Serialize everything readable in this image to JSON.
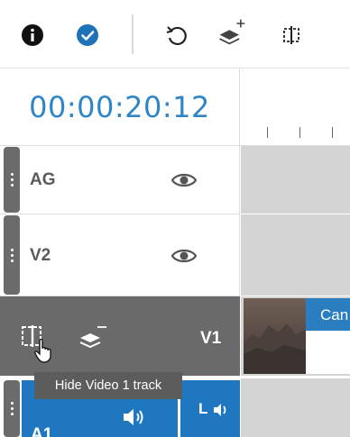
{
  "timecode": "00:00:20:12",
  "tracks": [
    {
      "name": "AG"
    },
    {
      "name": "V2"
    },
    {
      "name": "V1"
    },
    {
      "name": "A1"
    }
  ],
  "clip": {
    "label": "Can"
  },
  "audio": {
    "channel_label": "L"
  },
  "tooltip": "Hide Video 1 track",
  "icons": {
    "info": "info-icon",
    "check": "check-circle-icon",
    "undo": "undo-icon",
    "add_track": "layers-plus-icon",
    "split": "split-icon",
    "eye": "eye-icon",
    "hide_track": "hide-track-icon",
    "remove_layer": "layers-minus-icon",
    "speaker": "speaker-icon"
  },
  "colors": {
    "accent": "#2f86c6",
    "active_track": "#6a6a6a",
    "audio_track": "#1f78bf"
  }
}
